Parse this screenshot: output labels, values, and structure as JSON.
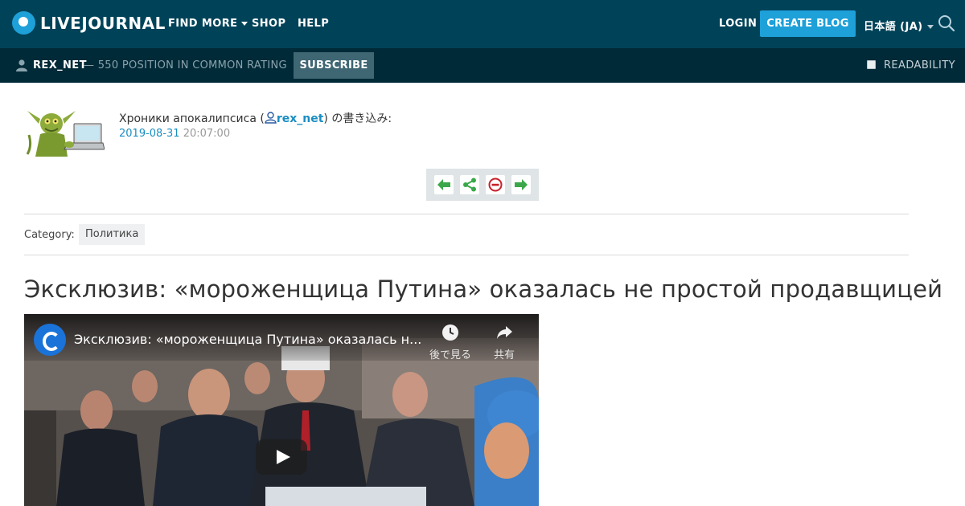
{
  "nav": {
    "logo_text": "LIVEJOURNAL",
    "find_more": "FIND MORE",
    "shop": "SHOP",
    "help": "HELP",
    "login": "LOGIN",
    "create_blog": "CREATE BLOG",
    "language": "日本語 (JA)"
  },
  "subbar": {
    "username": "REX_NET",
    "rating": "— 550 POSITION IN COMMON RATING",
    "subscribe": "SUBSCRIBE",
    "readability": "READABILITY"
  },
  "post": {
    "journal_name": "Хроники апокалипсиса (",
    "username": "rex_net",
    "wrote_suffix": ") の書き込み:",
    "date": "2019-08-31",
    "time": "20:07:00",
    "category_label": "Category:",
    "category": "Политика",
    "title": "Эксклюзив: «мороженщица Путина» оказалась не простой продавщицей"
  },
  "video": {
    "title": "Эксклюзив: «мороженщица Путина» оказалась н...",
    "watch_later": "後で見る",
    "share": "共有"
  },
  "colors": {
    "topbar": "#004359",
    "subbar": "#002a38",
    "accent": "#1ea0d8",
    "link": "#1a8ec2"
  },
  "icons": [
    "search-icon",
    "user-icon",
    "prev-arrow-icon",
    "share-icon",
    "block-icon",
    "next-arrow-icon",
    "clock-icon",
    "share-arrow-icon",
    "play-icon"
  ]
}
